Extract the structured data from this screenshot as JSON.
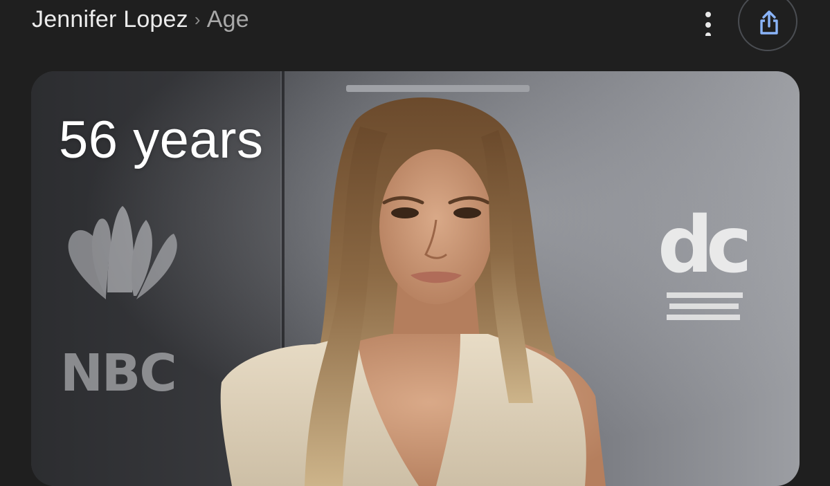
{
  "breadcrumb": {
    "root": "Jennifer Lopez",
    "separator": "›",
    "leaf": "Age"
  },
  "actions": {
    "more_icon": "more-vert-icon",
    "share_icon": "share-icon"
  },
  "card": {
    "age": "56 years",
    "backdrop_logos": [
      "NBC",
      "dc"
    ]
  },
  "colors": {
    "background": "#1f1f1f",
    "text_primary": "#ececec",
    "text_secondary": "#a9a9a9",
    "accent_blue": "#8ab4f8"
  }
}
